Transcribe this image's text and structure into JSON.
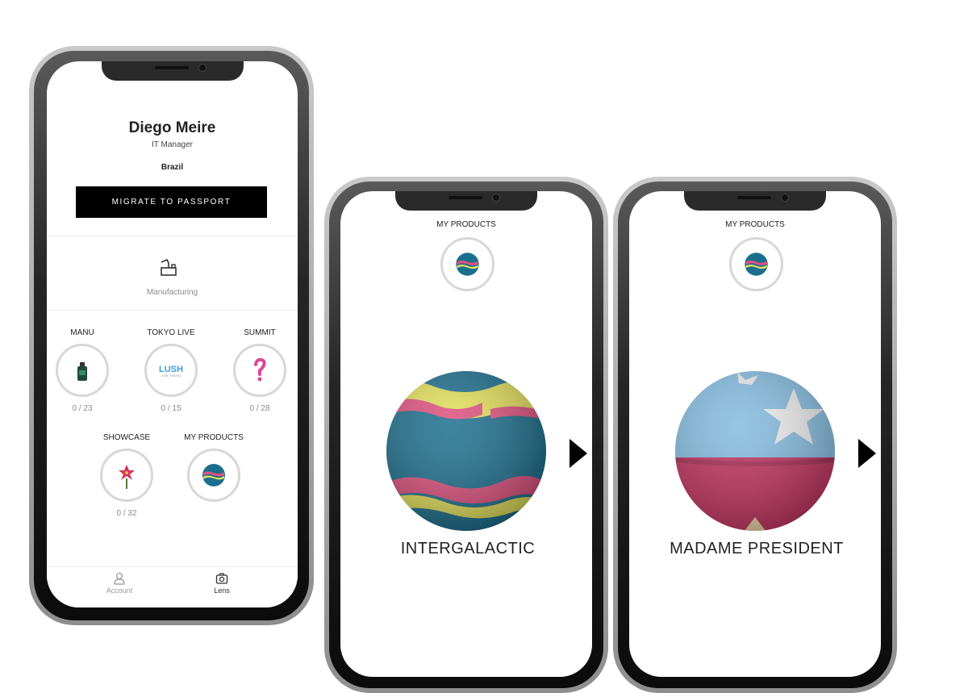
{
  "profile_screen": {
    "user_name": "Diego Meire",
    "role": "IT Manager",
    "country": "Brazil",
    "migrate_button": "MIGRATE TO PASSPORT",
    "section_label": "Manufacturing",
    "categories": [
      {
        "label": "MANU",
        "count": "0 / 23",
        "icon": "bottle-icon"
      },
      {
        "label": "TOKYO LIVE",
        "count": "0 / 15",
        "icon": "lush-live-tokyo-logo"
      },
      {
        "label": "SUMMIT",
        "count": "0 / 28",
        "icon": "question-mark-icon"
      },
      {
        "label": "SHOWCASE",
        "count": "0 / 32",
        "icon": "flower-icon"
      },
      {
        "label": "MY PRODUCTS",
        "count": "",
        "icon": "bath-bomb-icon"
      }
    ],
    "logo_text": "LUSH",
    "logo_subtext": "LIVE TOKYO",
    "tabs": [
      {
        "label": "Account",
        "icon": "person-icon",
        "active": false
      },
      {
        "label": "Lens",
        "icon": "camera-icon",
        "active": true
      }
    ]
  },
  "product_screens": [
    {
      "header": "MY PRODUCTS",
      "product_name": "INTERGALACTIC"
    },
    {
      "header": "MY PRODUCTS",
      "product_name": "MADAME PRESIDENT"
    }
  ],
  "colors": {
    "button_bg": "#000000",
    "ring_border": "#d7d7d7",
    "ball_blue": "#1b6f8e",
    "ball_yellow": "#e6e25a",
    "ball_pink": "#e0507f",
    "flag_blue": "#86bde0",
    "flag_red": "#c13460"
  }
}
